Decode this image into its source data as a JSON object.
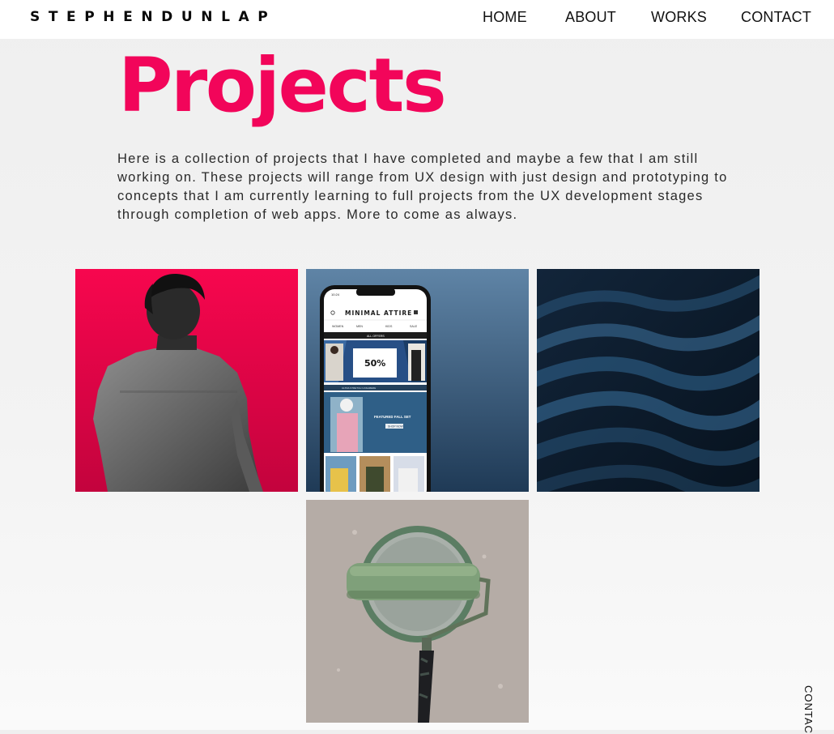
{
  "header": {
    "logo": "STEPHENDUNLAP",
    "nav": [
      "HOME",
      "ABOUT",
      "WORKS",
      "CONTACT"
    ]
  },
  "main": {
    "title": "Projects",
    "intro": "Here is a collection of projects that I have completed and maybe a few that I am still working on. These projects will range from UX design with just design and prototyping to concepts that I am currently learning to full projects from the UX development stages through completion of web apps. More to come as always."
  },
  "phone_mockup": {
    "time": "10:24",
    "brand": "MINIMAL ATTIRE",
    "menu": [
      "WOMEN",
      "MEN",
      "KIDS",
      "SALE"
    ],
    "banner_top": "ALL OFFERS",
    "sale_percent": "50%",
    "strip": "ULTRA STRETCH CASHMERE",
    "featured": "FEATURED FALL SET",
    "cta": "SHOP NOW"
  },
  "side": {
    "vertical_label": "CONTAC"
  },
  "colors": {
    "accent": "#f2055a",
    "text": "#111111",
    "header_bg": "#ffffff"
  }
}
